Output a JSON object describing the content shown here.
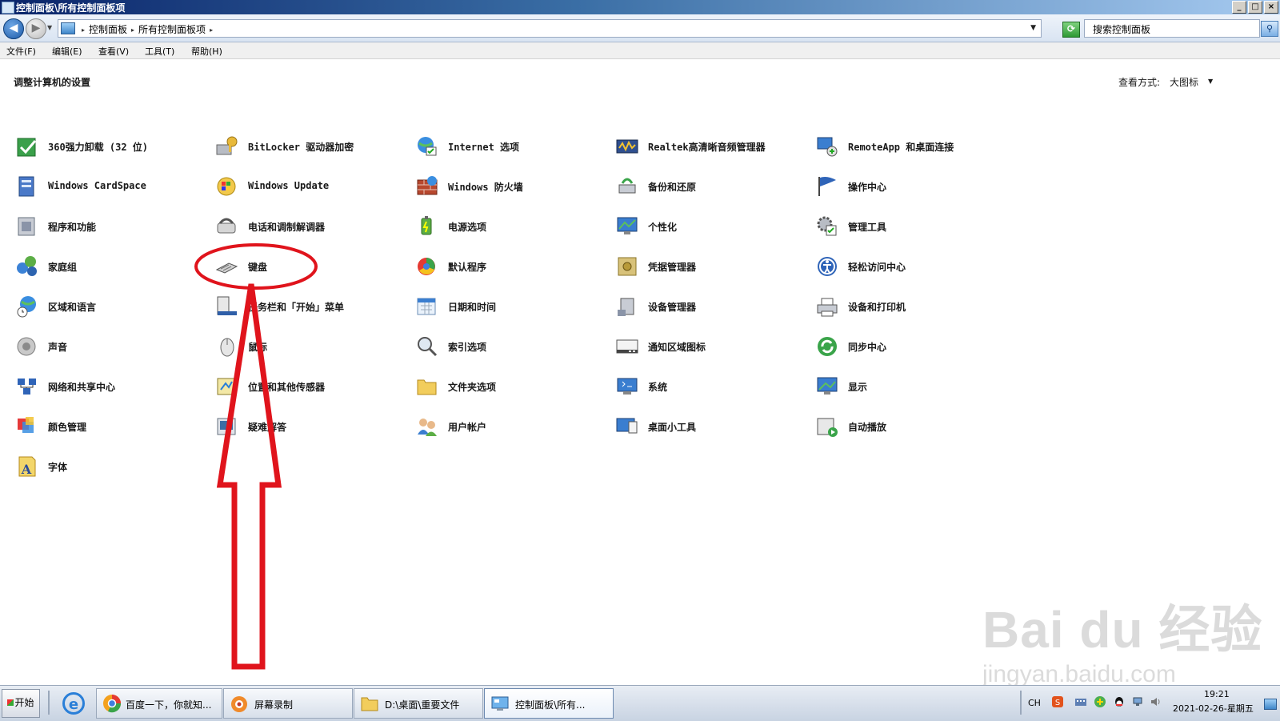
{
  "window": {
    "title": "控制面板\\所有控制面板项",
    "buttons": {
      "minimize": "_",
      "maximize": "□",
      "close": "×"
    }
  },
  "address": {
    "crumbs": [
      "控制面板",
      "所有控制面板项"
    ],
    "search_placeholder": "搜索控制面板"
  },
  "menu": [
    "文件(F)",
    "编辑(E)",
    "查看(V)",
    "工具(T)",
    "帮助(H)"
  ],
  "content": {
    "heading": "调整计算机的设置",
    "view_by_label": "查看方式:",
    "view_mode": "大图标"
  },
  "columns": [
    [
      {
        "label": "360强力卸载 (32 位)",
        "icon": "uninstall-icon"
      },
      {
        "label": "Windows CardSpace",
        "icon": "cardspace-icon"
      },
      {
        "label": "程序和功能",
        "icon": "programs-icon"
      },
      {
        "label": "家庭组",
        "icon": "homegroup-icon"
      },
      {
        "label": "区域和语言",
        "icon": "globe-clock-icon"
      },
      {
        "label": "声音",
        "icon": "speaker-icon"
      },
      {
        "label": "网络和共享中心",
        "icon": "network-icon"
      },
      {
        "label": "颜色管理",
        "icon": "color-icon"
      },
      {
        "label": "字体",
        "icon": "font-icon"
      }
    ],
    [
      {
        "label": "BitLocker 驱动器加密",
        "icon": "bitlocker-key-icon"
      },
      {
        "label": "Windows Update",
        "icon": "windows-update-icon"
      },
      {
        "label": "电话和调制解调器",
        "icon": "phone-modem-icon"
      },
      {
        "label": "键盘",
        "icon": "keyboard-icon"
      },
      {
        "label": "任务栏和「开始」菜单",
        "icon": "taskbar-icon"
      },
      {
        "label": "鼠标",
        "icon": "mouse-icon"
      },
      {
        "label": "位置和其他传感器",
        "icon": "sensor-icon"
      },
      {
        "label": "疑难解答",
        "icon": "troubleshoot-icon"
      }
    ],
    [
      {
        "label": "Internet 选项",
        "icon": "internet-options-icon"
      },
      {
        "label": "Windows 防火墙",
        "icon": "firewall-icon"
      },
      {
        "label": "电源选项",
        "icon": "power-icon"
      },
      {
        "label": "默认程序",
        "icon": "default-programs-icon"
      },
      {
        "label": "日期和时间",
        "icon": "calendar-icon"
      },
      {
        "label": "索引选项",
        "icon": "index-search-icon"
      },
      {
        "label": "文件夹选项",
        "icon": "folder-icon"
      },
      {
        "label": "用户帐户",
        "icon": "users-icon"
      }
    ],
    [
      {
        "label": "Realtek高清晰音频管理器",
        "icon": "audio-manager-icon"
      },
      {
        "label": "备份和还原",
        "icon": "backup-icon"
      },
      {
        "label": "个性化",
        "icon": "personalize-icon"
      },
      {
        "label": "凭据管理器",
        "icon": "credential-safe-icon"
      },
      {
        "label": "设备管理器",
        "icon": "device-manager-icon"
      },
      {
        "label": "通知区域图标",
        "icon": "notification-icon"
      },
      {
        "label": "系统",
        "icon": "system-icon"
      },
      {
        "label": "桌面小工具",
        "icon": "gadgets-icon"
      }
    ],
    [
      {
        "label": "RemoteApp 和桌面连接",
        "icon": "remoteapp-icon"
      },
      {
        "label": "操作中心",
        "icon": "action-center-flag-icon"
      },
      {
        "label": "管理工具",
        "icon": "admin-tools-icon"
      },
      {
        "label": "轻松访问中心",
        "icon": "ease-of-access-icon"
      },
      {
        "label": "设备和打印机",
        "icon": "printer-icon"
      },
      {
        "label": "同步中心",
        "icon": "sync-icon"
      },
      {
        "label": "显示",
        "icon": "display-icon"
      },
      {
        "label": "自动播放",
        "icon": "autoplay-icon"
      }
    ]
  ],
  "watermark": {
    "brand": "Bai du 经验",
    "url": "jingyan.baidu.com"
  },
  "taskbar": {
    "start": "开始",
    "tasks": [
      {
        "label": "百度一下，你就知...",
        "icon": "browser-icon"
      },
      {
        "label": "屏幕录制",
        "icon": "recorder-icon"
      },
      {
        "label": "D:\\桌面\\重要文件",
        "icon": "folder-icon"
      },
      {
        "label": "控制面板\\所有...",
        "icon": "control-panel-icon"
      }
    ],
    "lang": "CH",
    "time": "19:21",
    "date": "2021-02-26-星期五"
  },
  "colors": {
    "annotation": "#e0141c",
    "title_gradient_start": "#0a246a"
  }
}
